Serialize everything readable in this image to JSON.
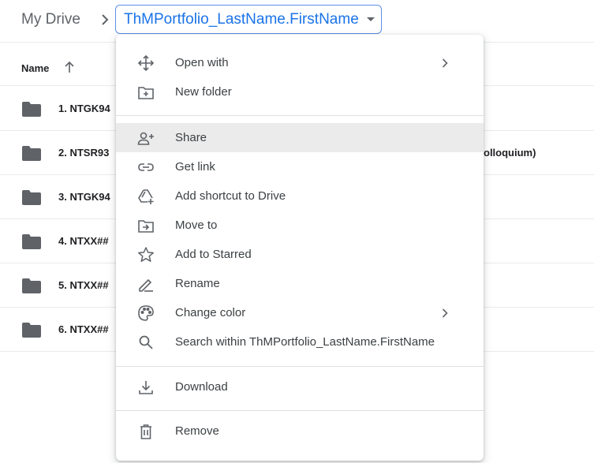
{
  "breadcrumb": {
    "root": "My Drive",
    "current": "ThMPortfolio_LastName.FirstName",
    "separator_icon": "chevron-right-icon",
    "dropdown_icon": "caret-down-icon"
  },
  "list": {
    "header": {
      "name": "Name",
      "sort_icon": "arrow-up-icon"
    },
    "rows": [
      {
        "name": "1. NTGK94"
      },
      {
        "name": "2. NTSR93",
        "tail": "olloquium)"
      },
      {
        "name": "3. NTGK94"
      },
      {
        "name": "4. NTXX##"
      },
      {
        "name": "5. NTXX##"
      },
      {
        "name": "6. NTXX##"
      }
    ]
  },
  "context_menu": {
    "items": [
      {
        "label": "Open with",
        "icon": "open-with-icon",
        "submenu": true
      },
      {
        "label": "New folder",
        "icon": "new-folder-icon"
      },
      {
        "label": "Share",
        "icon": "share-person-add-icon",
        "highlighted": true
      },
      {
        "label": "Get link",
        "icon": "link-icon"
      },
      {
        "label": "Add shortcut to Drive",
        "icon": "add-shortcut-drive-icon"
      },
      {
        "label": "Move to",
        "icon": "move-to-folder-icon"
      },
      {
        "label": "Add to Starred",
        "icon": "star-outline-icon"
      },
      {
        "label": "Rename",
        "icon": "pencil-rename-icon"
      },
      {
        "label": "Change color",
        "icon": "palette-icon",
        "submenu": true
      },
      {
        "label": "Search within ThMPortfolio_LastName.FirstName",
        "icon": "search-icon"
      },
      {
        "label": "Download",
        "icon": "download-icon"
      },
      {
        "label": "Remove",
        "icon": "trash-icon"
      }
    ]
  },
  "colors": {
    "accent": "#1a73e8",
    "highlight": "#ebebeb",
    "text": "#3c4043",
    "icon": "#5f6368"
  }
}
